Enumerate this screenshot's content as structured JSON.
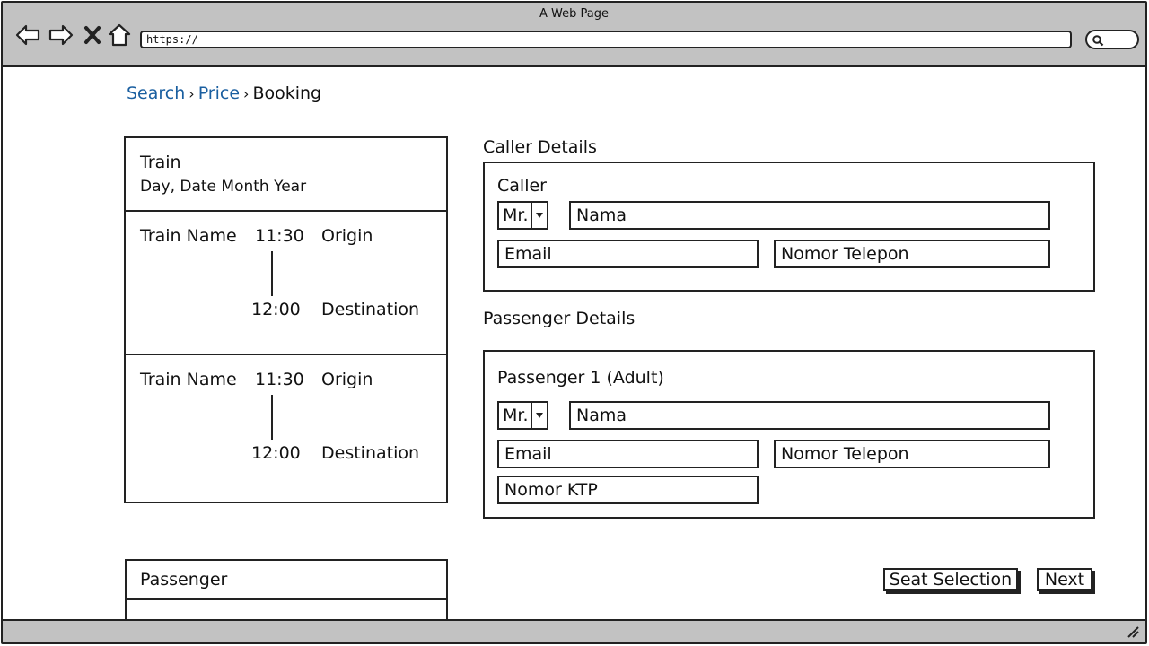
{
  "browser": {
    "window_title": "A Web Page",
    "url": "https://"
  },
  "breadcrumb": {
    "items": [
      "Search",
      "Price",
      "Booking"
    ],
    "separator": "›"
  },
  "train_summary": {
    "title": "Train",
    "date": "Day, Date Month Year",
    "trips": [
      {
        "name": "Train Name",
        "departure": "11:30",
        "arrival": "12:00",
        "origin": "Origin",
        "destination": "Destination"
      },
      {
        "name": "Train Name",
        "departure": "11:30",
        "arrival": "12:00",
        "origin": "Origin",
        "destination": "Destination"
      }
    ]
  },
  "passenger_panel": {
    "title": "Passenger"
  },
  "caller_details": {
    "section_title": "Caller Details",
    "label": "Caller",
    "title_select": "Mr.",
    "name_field": "Nama",
    "email_field": "Email",
    "phone_field": "Nomor Telepon"
  },
  "passenger_details": {
    "section_title": "Passenger Details",
    "label": "Passenger 1 (Adult)",
    "title_select": "Mr.",
    "name_field": "Nama",
    "email_field": "Email",
    "phone_field": "Nomor Telepon",
    "id_field": "Nomor KTP"
  },
  "actions": {
    "seat_selection": "Seat Selection",
    "next": "Next"
  },
  "icons": {
    "back": "back-arrow-icon",
    "forward": "forward-arrow-icon",
    "stop": "close-icon",
    "home": "home-icon",
    "search": "search-icon",
    "dropdown": "chevron-down-icon",
    "resize": "resize-grip-icon"
  }
}
